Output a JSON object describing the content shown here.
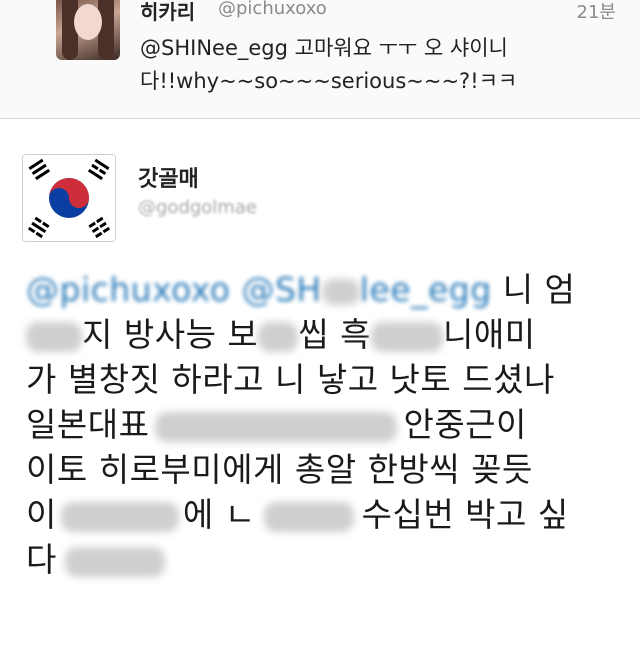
{
  "top_tweet": {
    "name": "히카리",
    "handle": "@pichuxoxo",
    "time": "21분",
    "text": "@SHINee_egg 고마워요 ㅜㅜ 오 샤이니다!!why~~so~~~serious~~~?!ㅋㅋ"
  },
  "main_tweet": {
    "name": "갓골매",
    "handle": "@godgolmae",
    "lines": [
      {
        "pre": "@pichuxoxo @SH",
        "post": "lee_egg 니 엄"
      },
      {
        "pre": "",
        "post": "지 방사능 보",
        "tail": "씹 흑",
        "end": "니애미"
      },
      {
        "text": "가 별창짓 하라고 니 낳고 낫토 드셨나"
      },
      {
        "pre": "일본대표",
        "end": "안중근이"
      },
      {
        "text": "이토 히로부미에게 총알 한방씩 꽂듯"
      },
      {
        "pre": "이",
        "mid": "에 ㄴ",
        "end": "수십번 박고 싶"
      },
      {
        "pre": "다"
      }
    ]
  },
  "colors": {
    "mention": "#2b7bb9",
    "top_background": "#fafafa",
    "divider": "#d8d8d8"
  },
  "icons": {
    "flag": "korean-flag-avatar"
  }
}
